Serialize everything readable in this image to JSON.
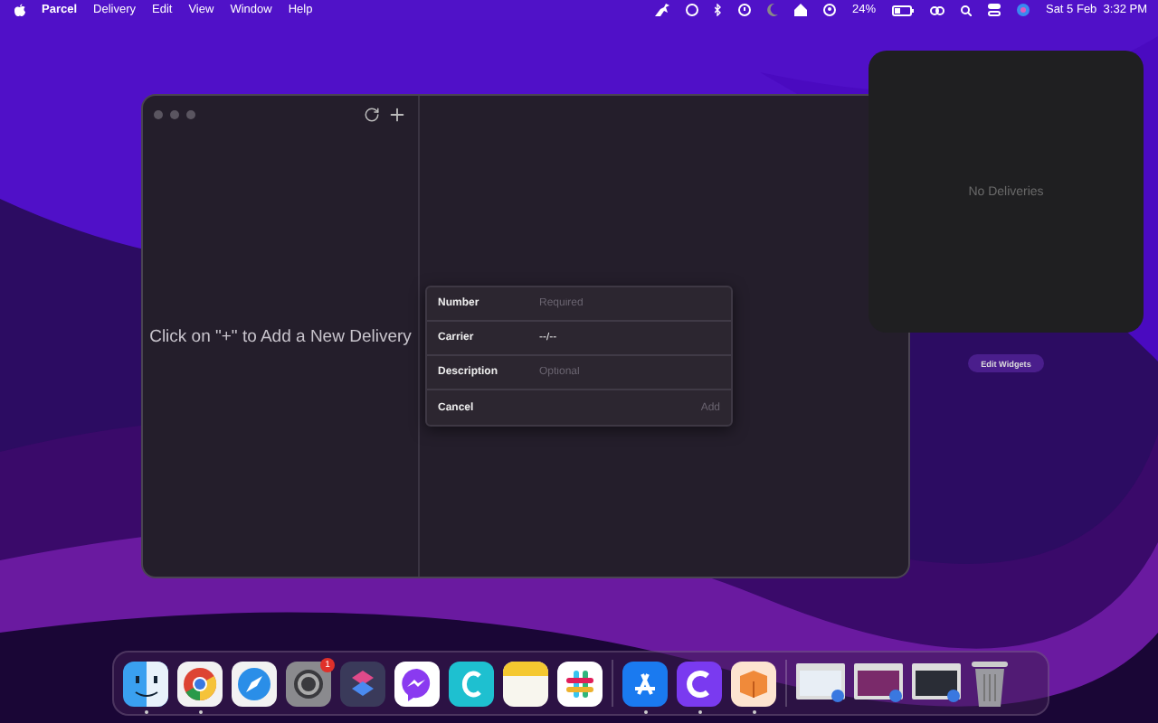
{
  "menu_bar": {
    "app_name": "Parcel",
    "menus": [
      "Delivery",
      "Edit",
      "View",
      "Window",
      "Help"
    ],
    "battery_percent": "24%",
    "datetime": "Sat 5 Feb  3:32 PM"
  },
  "window": {
    "empty_hint": "Click on \"+\" to Add a New Delivery"
  },
  "popover": {
    "fields": [
      {
        "label": "Number",
        "placeholder": "Required"
      },
      {
        "label": "Carrier",
        "value": "--/--"
      },
      {
        "label": "Description",
        "placeholder": "Optional"
      }
    ],
    "cancel": "Cancel",
    "add": {
      "label": "Add",
      "disabled": true
    }
  },
  "widget": {
    "empty_text": "No Deliveries",
    "edit_button": "Edit Widgets"
  },
  "dock": [
    {
      "kind": "finder",
      "running": true
    },
    {
      "kind": "chrome",
      "running": true
    },
    {
      "kind": "safari",
      "running": false
    },
    {
      "kind": "settings",
      "running": false,
      "badge": "1"
    },
    {
      "kind": "shortcuts",
      "running": false
    },
    {
      "kind": "messenger",
      "running": false
    },
    {
      "kind": "canva",
      "running": false
    },
    {
      "kind": "notes",
      "running": false
    },
    {
      "kind": "slack",
      "running": false
    },
    {
      "kind": "separator"
    },
    {
      "kind": "appstore",
      "running": true
    },
    {
      "kind": "cleaner",
      "running": true
    },
    {
      "kind": "parcel",
      "running": true
    },
    {
      "kind": "separator"
    },
    {
      "kind": "window",
      "running": false,
      "color": "#e8eef5"
    },
    {
      "kind": "window",
      "running": false,
      "color": "#7a2a6a"
    },
    {
      "kind": "window",
      "running": false,
      "color": "#2a2d36"
    },
    {
      "kind": "trash",
      "running": false
    }
  ]
}
